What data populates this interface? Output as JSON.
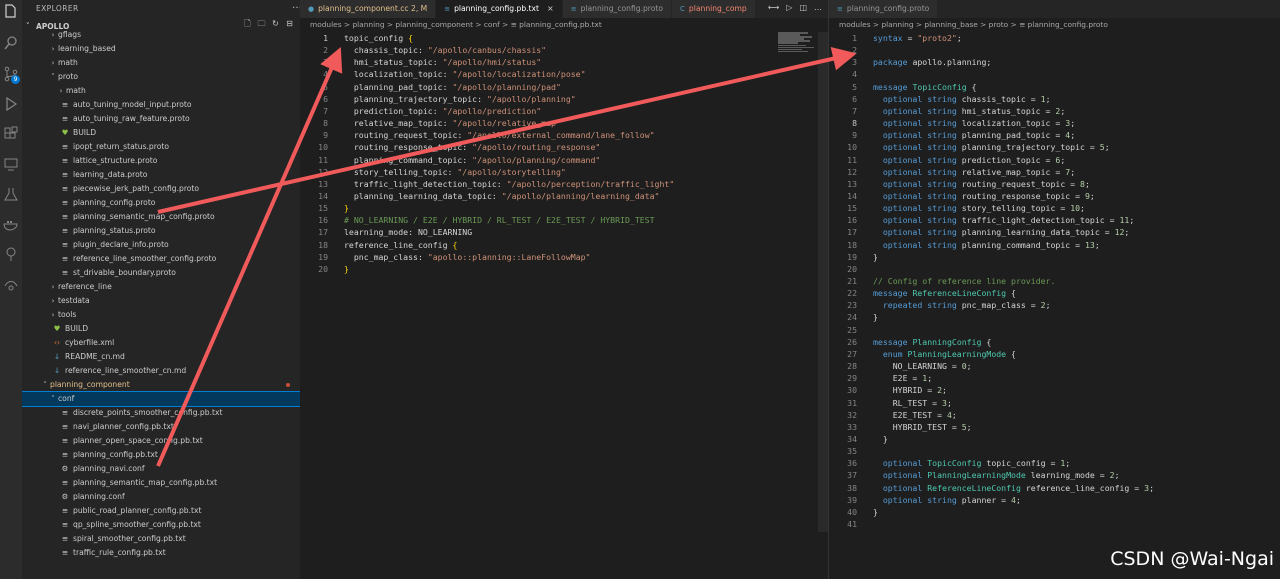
{
  "explorer": {
    "title": "EXPLORER",
    "root": "APOLLO",
    "rows": [
      {
        "label": "gflags",
        "indent": 2,
        "kind": "folder",
        "open": false
      },
      {
        "label": "learning_based",
        "indent": 2,
        "kind": "folder",
        "open": false
      },
      {
        "label": "math",
        "indent": 2,
        "kind": "folder",
        "open": false
      },
      {
        "label": "proto",
        "indent": 2,
        "kind": "folder",
        "open": true
      },
      {
        "label": "math",
        "indent": 3,
        "kind": "folder",
        "open": false
      },
      {
        "label": "auto_tuning_model_input.proto",
        "indent": 3,
        "kind": "proto"
      },
      {
        "label": "auto_tuning_raw_feature.proto",
        "indent": 3,
        "kind": "proto"
      },
      {
        "label": "BUILD",
        "indent": 3,
        "kind": "build"
      },
      {
        "label": "ipopt_return_status.proto",
        "indent": 3,
        "kind": "proto"
      },
      {
        "label": "lattice_structure.proto",
        "indent": 3,
        "kind": "proto"
      },
      {
        "label": "learning_data.proto",
        "indent": 3,
        "kind": "proto"
      },
      {
        "label": "piecewise_jerk_path_config.proto",
        "indent": 3,
        "kind": "proto"
      },
      {
        "label": "planning_config.proto",
        "indent": 3,
        "kind": "proto"
      },
      {
        "label": "planning_semantic_map_config.proto",
        "indent": 3,
        "kind": "proto"
      },
      {
        "label": "planning_status.proto",
        "indent": 3,
        "kind": "proto"
      },
      {
        "label": "plugin_declare_info.proto",
        "indent": 3,
        "kind": "proto"
      },
      {
        "label": "reference_line_smoother_config.proto",
        "indent": 3,
        "kind": "proto"
      },
      {
        "label": "st_drivable_boundary.proto",
        "indent": 3,
        "kind": "proto"
      },
      {
        "label": "reference_line",
        "indent": 2,
        "kind": "folder",
        "open": false
      },
      {
        "label": "testdata",
        "indent": 2,
        "kind": "folder",
        "open": false
      },
      {
        "label": "tools",
        "indent": 2,
        "kind": "folder",
        "open": false
      },
      {
        "label": "BUILD",
        "indent": 2,
        "kind": "build"
      },
      {
        "label": "cyberfile.xml",
        "indent": 2,
        "kind": "xml"
      },
      {
        "label": "README_cn.md",
        "indent": 2,
        "kind": "md"
      },
      {
        "label": "reference_line_smoother_cn.md",
        "indent": 2,
        "kind": "md"
      },
      {
        "label": "planning_component",
        "indent": 1,
        "kind": "folder",
        "open": true,
        "modified": true
      },
      {
        "label": "conf",
        "indent": 2,
        "kind": "folder",
        "open": true,
        "selected": true
      },
      {
        "label": "discrete_points_smoother_config.pb.txt",
        "indent": 3,
        "kind": "proto"
      },
      {
        "label": "navi_planner_config.pb.txt",
        "indent": 3,
        "kind": "proto"
      },
      {
        "label": "planner_open_space_config.pb.txt",
        "indent": 3,
        "kind": "proto"
      },
      {
        "label": "planning_config.pb.txt",
        "indent": 3,
        "kind": "proto"
      },
      {
        "label": "planning_navi.conf",
        "indent": 3,
        "kind": "gear"
      },
      {
        "label": "planning_semantic_map_config.pb.txt",
        "indent": 3,
        "kind": "proto"
      },
      {
        "label": "planning.conf",
        "indent": 3,
        "kind": "gear"
      },
      {
        "label": "public_road_planner_config.pb.txt",
        "indent": 3,
        "kind": "proto"
      },
      {
        "label": "qp_spline_smoother_config.pb.txt",
        "indent": 3,
        "kind": "proto"
      },
      {
        "label": "spiral_smoother_config.pb.txt",
        "indent": 3,
        "kind": "proto"
      },
      {
        "label": "traffic_rule_config.pb.txt",
        "indent": 3,
        "kind": "proto"
      }
    ]
  },
  "editor1": {
    "tabs": [
      {
        "label": "planning_component.cc 2, M",
        "state": "modified"
      },
      {
        "label": "planning_config.pb.txt",
        "state": "active"
      },
      {
        "label": "planning_config.proto",
        "state": ""
      },
      {
        "label": "planning_comp",
        "state": "red"
      }
    ],
    "breadcrumb": "modules > planning > planning_component > conf > ≡ planning_config.pb.txt",
    "lines": [
      [
        [
          "p",
          "topic_config "
        ],
        [
          "y",
          "{"
        ]
      ],
      [
        [
          "p",
          "  chassis_topic: "
        ],
        [
          "s",
          "\"/apollo/canbus/chassis\""
        ]
      ],
      [
        [
          "p",
          "  hmi_status_topic: "
        ],
        [
          "s",
          "\"/apollo/hmi/status\""
        ]
      ],
      [
        [
          "p",
          "  localization_topic: "
        ],
        [
          "s",
          "\"/apollo/localization/pose\""
        ]
      ],
      [
        [
          "p",
          "  planning_pad_topic: "
        ],
        [
          "s",
          "\"/apollo/planning/pad\""
        ]
      ],
      [
        [
          "p",
          "  planning_trajectory_topic: "
        ],
        [
          "s",
          "\"/apollo/planning\""
        ]
      ],
      [
        [
          "p",
          "  prediction_topic: "
        ],
        [
          "s",
          "\"/apollo/prediction\""
        ]
      ],
      [
        [
          "p",
          "  relative_map_topic: "
        ],
        [
          "s",
          "\"/apollo/relative_map\""
        ]
      ],
      [
        [
          "p",
          "  routing_request_topic: "
        ],
        [
          "s",
          "\"/apollo/external_command/lane_follow\""
        ]
      ],
      [
        [
          "p",
          "  routing_response_topic: "
        ],
        [
          "s",
          "\"/apollo/routing_response\""
        ]
      ],
      [
        [
          "p",
          "  planning_command_topic: "
        ],
        [
          "s",
          "\"/apollo/planning/command\""
        ]
      ],
      [
        [
          "p",
          "  story_telling_topic: "
        ],
        [
          "s",
          "\"/apollo/storytelling\""
        ]
      ],
      [
        [
          "p",
          "  traffic_light_detection_topic: "
        ],
        [
          "s",
          "\"/apollo/perception/traffic_light\""
        ]
      ],
      [
        [
          "p",
          "  planning_learning_data_topic: "
        ],
        [
          "s",
          "\"/apollo/planning/learning_data\""
        ]
      ],
      [
        [
          "y",
          "}"
        ]
      ],
      [
        [
          "c",
          "# NO_LEARNING / E2E / HYBRID / RL_TEST / E2E_TEST / HYBRID_TEST"
        ]
      ],
      [
        [
          "p",
          "learning_mode: NO_LEARNING"
        ]
      ],
      [
        [
          "p",
          "reference_line_config "
        ],
        [
          "y",
          "{"
        ]
      ],
      [
        [
          "p",
          "  pnc_map_class: "
        ],
        [
          "s",
          "\"apollo::planning::LaneFollowMap\""
        ]
      ],
      [
        [
          "y",
          "}"
        ]
      ]
    ]
  },
  "editor2": {
    "tabs": [
      {
        "label": "planning_config.proto",
        "state": ""
      }
    ],
    "breadcrumb": "modules > planning > planning_base > proto > ≡ planning_config.proto",
    "lines": [
      [
        [
          "k",
          "syntax"
        ],
        [
          "p",
          " = "
        ],
        [
          "s",
          "\"proto2\""
        ],
        [
          "p",
          ";"
        ]
      ],
      [],
      [
        [
          "k",
          "package"
        ],
        [
          "p",
          " apollo.planning;"
        ]
      ],
      [],
      [
        [
          "k",
          "message"
        ],
        [
          "p",
          " "
        ],
        [
          "t",
          "TopicConfig"
        ],
        [
          "p",
          " {"
        ]
      ],
      [
        [
          "p",
          "  "
        ],
        [
          "k",
          "optional"
        ],
        [
          "p",
          " "
        ],
        [
          "k",
          "string"
        ],
        [
          "p",
          " chassis_topic = "
        ],
        [
          "n",
          "1"
        ],
        [
          "p",
          ";"
        ]
      ],
      [
        [
          "p",
          "  "
        ],
        [
          "k",
          "optional"
        ],
        [
          "p",
          " "
        ],
        [
          "k",
          "string"
        ],
        [
          "p",
          " hmi_status_topic = "
        ],
        [
          "n",
          "2"
        ],
        [
          "p",
          ";"
        ]
      ],
      [
        [
          "p",
          "  "
        ],
        [
          "k",
          "optional"
        ],
        [
          "p",
          " "
        ],
        [
          "k",
          "string"
        ],
        [
          "p",
          " localization_topic = "
        ],
        [
          "n",
          "3"
        ],
        [
          "p",
          ";"
        ]
      ],
      [
        [
          "p",
          "  "
        ],
        [
          "k",
          "optional"
        ],
        [
          "p",
          " "
        ],
        [
          "k",
          "string"
        ],
        [
          "p",
          " planning_pad_topic = "
        ],
        [
          "n",
          "4"
        ],
        [
          "p",
          ";"
        ]
      ],
      [
        [
          "p",
          "  "
        ],
        [
          "k",
          "optional"
        ],
        [
          "p",
          " "
        ],
        [
          "k",
          "string"
        ],
        [
          "p",
          " planning_trajectory_topic = "
        ],
        [
          "n",
          "5"
        ],
        [
          "p",
          ";"
        ]
      ],
      [
        [
          "p",
          "  "
        ],
        [
          "k",
          "optional"
        ],
        [
          "p",
          " "
        ],
        [
          "k",
          "string"
        ],
        [
          "p",
          " prediction_topic = "
        ],
        [
          "n",
          "6"
        ],
        [
          "p",
          ";"
        ]
      ],
      [
        [
          "p",
          "  "
        ],
        [
          "k",
          "optional"
        ],
        [
          "p",
          " "
        ],
        [
          "k",
          "string"
        ],
        [
          "p",
          " relative_map_topic = "
        ],
        [
          "n",
          "7"
        ],
        [
          "p",
          ";"
        ]
      ],
      [
        [
          "p",
          "  "
        ],
        [
          "k",
          "optional"
        ],
        [
          "p",
          " "
        ],
        [
          "k",
          "string"
        ],
        [
          "p",
          " routing_request_topic = "
        ],
        [
          "n",
          "8"
        ],
        [
          "p",
          ";"
        ]
      ],
      [
        [
          "p",
          "  "
        ],
        [
          "k",
          "optional"
        ],
        [
          "p",
          " "
        ],
        [
          "k",
          "string"
        ],
        [
          "p",
          " routing_response_topic = "
        ],
        [
          "n",
          "9"
        ],
        [
          "p",
          ";"
        ]
      ],
      [
        [
          "p",
          "  "
        ],
        [
          "k",
          "optional"
        ],
        [
          "p",
          " "
        ],
        [
          "k",
          "string"
        ],
        [
          "p",
          " story_telling_topic = "
        ],
        [
          "n",
          "10"
        ],
        [
          "p",
          ";"
        ]
      ],
      [
        [
          "p",
          "  "
        ],
        [
          "k",
          "optional"
        ],
        [
          "p",
          " "
        ],
        [
          "k",
          "string"
        ],
        [
          "p",
          " traffic_light_detection_topic = "
        ],
        [
          "n",
          "11"
        ],
        [
          "p",
          ";"
        ]
      ],
      [
        [
          "p",
          "  "
        ],
        [
          "k",
          "optional"
        ],
        [
          "p",
          " "
        ],
        [
          "k",
          "string"
        ],
        [
          "p",
          " planning_learning_data_topic = "
        ],
        [
          "n",
          "12"
        ],
        [
          "p",
          ";"
        ]
      ],
      [
        [
          "p",
          "  "
        ],
        [
          "k",
          "optional"
        ],
        [
          "p",
          " "
        ],
        [
          "k",
          "string"
        ],
        [
          "p",
          " planning_command_topic = "
        ],
        [
          "n",
          "13"
        ],
        [
          "p",
          ";"
        ]
      ],
      [
        [
          "p",
          "}"
        ]
      ],
      [],
      [
        [
          "c",
          "// Config of reference line provider."
        ]
      ],
      [
        [
          "k",
          "message"
        ],
        [
          "p",
          " "
        ],
        [
          "t",
          "ReferenceLineConfig"
        ],
        [
          "p",
          " {"
        ]
      ],
      [
        [
          "p",
          "  "
        ],
        [
          "k",
          "repeated"
        ],
        [
          "p",
          " "
        ],
        [
          "k",
          "string"
        ],
        [
          "p",
          " pnc_map_class = "
        ],
        [
          "n",
          "2"
        ],
        [
          "p",
          ";"
        ]
      ],
      [
        [
          "p",
          "}"
        ]
      ],
      [],
      [
        [
          "k",
          "message"
        ],
        [
          "p",
          " "
        ],
        [
          "t",
          "PlanningConfig"
        ],
        [
          "p",
          " {"
        ]
      ],
      [
        [
          "p",
          "  "
        ],
        [
          "k",
          "enum"
        ],
        [
          "p",
          " "
        ],
        [
          "t",
          "PlanningLearningMode"
        ],
        [
          "p",
          " {"
        ]
      ],
      [
        [
          "p",
          "    NO_LEARNING = "
        ],
        [
          "n",
          "0"
        ],
        [
          "p",
          ";"
        ]
      ],
      [
        [
          "p",
          "    E2E = "
        ],
        [
          "n",
          "1"
        ],
        [
          "p",
          ";"
        ]
      ],
      [
        [
          "p",
          "    HYBRID = "
        ],
        [
          "n",
          "2"
        ],
        [
          "p",
          ";"
        ]
      ],
      [
        [
          "p",
          "    RL_TEST = "
        ],
        [
          "n",
          "3"
        ],
        [
          "p",
          ";"
        ]
      ],
      [
        [
          "p",
          "    E2E_TEST = "
        ],
        [
          "n",
          "4"
        ],
        [
          "p",
          ";"
        ]
      ],
      [
        [
          "p",
          "    HYBRID_TEST = "
        ],
        [
          "n",
          "5"
        ],
        [
          "p",
          ";"
        ]
      ],
      [
        [
          "p",
          "  }"
        ]
      ],
      [],
      [
        [
          "p",
          "  "
        ],
        [
          "k",
          "optional"
        ],
        [
          "p",
          " "
        ],
        [
          "t",
          "TopicConfig"
        ],
        [
          "p",
          " topic_config = "
        ],
        [
          "n",
          "1"
        ],
        [
          "p",
          ";"
        ]
      ],
      [
        [
          "p",
          "  "
        ],
        [
          "k",
          "optional"
        ],
        [
          "p",
          " "
        ],
        [
          "t",
          "PlanningLearningMode"
        ],
        [
          "p",
          " learning_mode = "
        ],
        [
          "n",
          "2"
        ],
        [
          "p",
          ";"
        ]
      ],
      [
        [
          "p",
          "  "
        ],
        [
          "k",
          "optional"
        ],
        [
          "p",
          " "
        ],
        [
          "t",
          "ReferenceLineConfig"
        ],
        [
          "p",
          " reference_line_config = "
        ],
        [
          "n",
          "3"
        ],
        [
          "p",
          ";"
        ]
      ],
      [
        [
          "p",
          "  "
        ],
        [
          "k",
          "optional"
        ],
        [
          "p",
          " "
        ],
        [
          "k",
          "string"
        ],
        [
          "p",
          " planner = "
        ],
        [
          "n",
          "4"
        ],
        [
          "p",
          ";"
        ]
      ],
      [
        [
          "p",
          "}"
        ]
      ],
      []
    ]
  },
  "watermark": "CSDN @Wai-Ngai",
  "colors": {
    "arrow": "#f05a5a",
    "accent": "#007fd4"
  }
}
